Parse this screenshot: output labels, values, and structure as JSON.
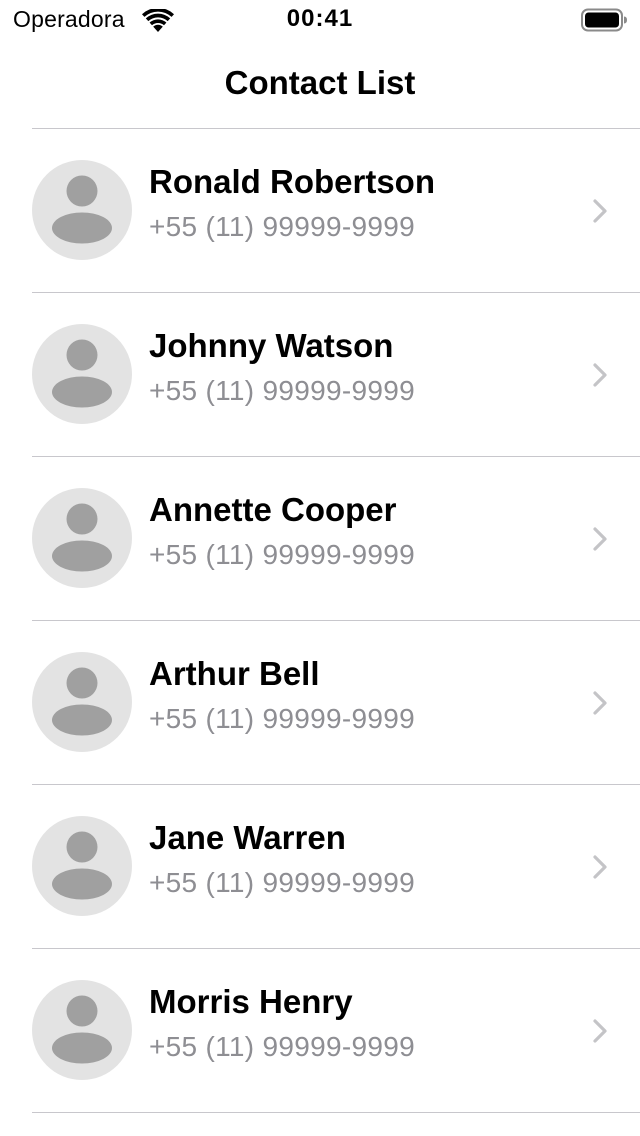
{
  "status_bar": {
    "carrier": "Operadora",
    "time": "00:41",
    "icons": [
      "wifi-icon",
      "battery-icon"
    ]
  },
  "nav_bar": {
    "title": "Contact List"
  },
  "colors": {
    "background": "#ffffff",
    "separator": "#c8c7cc",
    "secondary_text": "#8e8e93",
    "avatar_background": "#e3e3e3",
    "avatar_silhouette": "#a0a0a0",
    "chevron": "#c4c4c7"
  },
  "contacts": [
    {
      "name": "Ronald Robertson",
      "phone": "+55 (11) 99999-9999",
      "icon": "avatar-placeholder-icon"
    },
    {
      "name": "Johnny Watson",
      "phone": "+55 (11) 99999-9999",
      "icon": "avatar-placeholder-icon"
    },
    {
      "name": "Annette Cooper",
      "phone": "+55 (11) 99999-9999",
      "icon": "avatar-placeholder-icon"
    },
    {
      "name": "Arthur Bell",
      "phone": "+55 (11) 99999-9999",
      "icon": "avatar-placeholder-icon"
    },
    {
      "name": "Jane Warren",
      "phone": "+55 (11) 99999-9999",
      "icon": "avatar-placeholder-icon"
    },
    {
      "name": "Morris Henry",
      "phone": "+55 (11) 99999-9999",
      "icon": "avatar-placeholder-icon"
    }
  ]
}
